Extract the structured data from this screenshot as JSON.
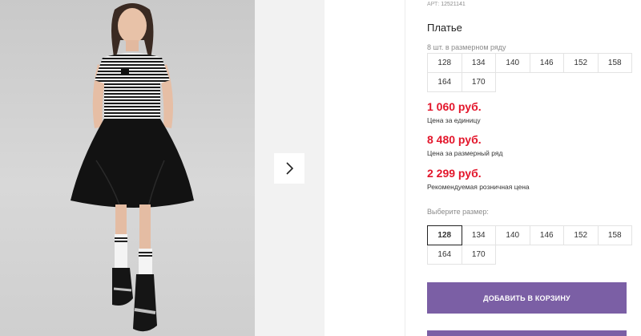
{
  "product": {
    "sku_label": "АРТ:",
    "sku_value": "12521141",
    "title": "Платье"
  },
  "pack": {
    "label": "8 шт. в размерном ряду",
    "sizes": [
      "128",
      "134",
      "140",
      "146",
      "152",
      "158",
      "164",
      "170"
    ]
  },
  "prices": [
    {
      "value": "1 060 руб.",
      "note": "Цена за единицу"
    },
    {
      "value": "8 480 руб.",
      "note": "Цена за размерный ряд"
    },
    {
      "value": "2 299 руб.",
      "note": "Рекомендуемая розничная цена"
    }
  ],
  "size_select": {
    "label": "Выберите размер:",
    "sizes": [
      "128",
      "134",
      "140",
      "146",
      "152",
      "158",
      "164",
      "170"
    ],
    "selected": "128"
  },
  "actions": {
    "add_to_cart": "ДОБАВИТЬ В КОРЗИНУ"
  },
  "gallery": {
    "next_icon": "chevron-right-icon"
  },
  "colors": {
    "price": "#e3162b",
    "button": "#7b5fa5"
  }
}
